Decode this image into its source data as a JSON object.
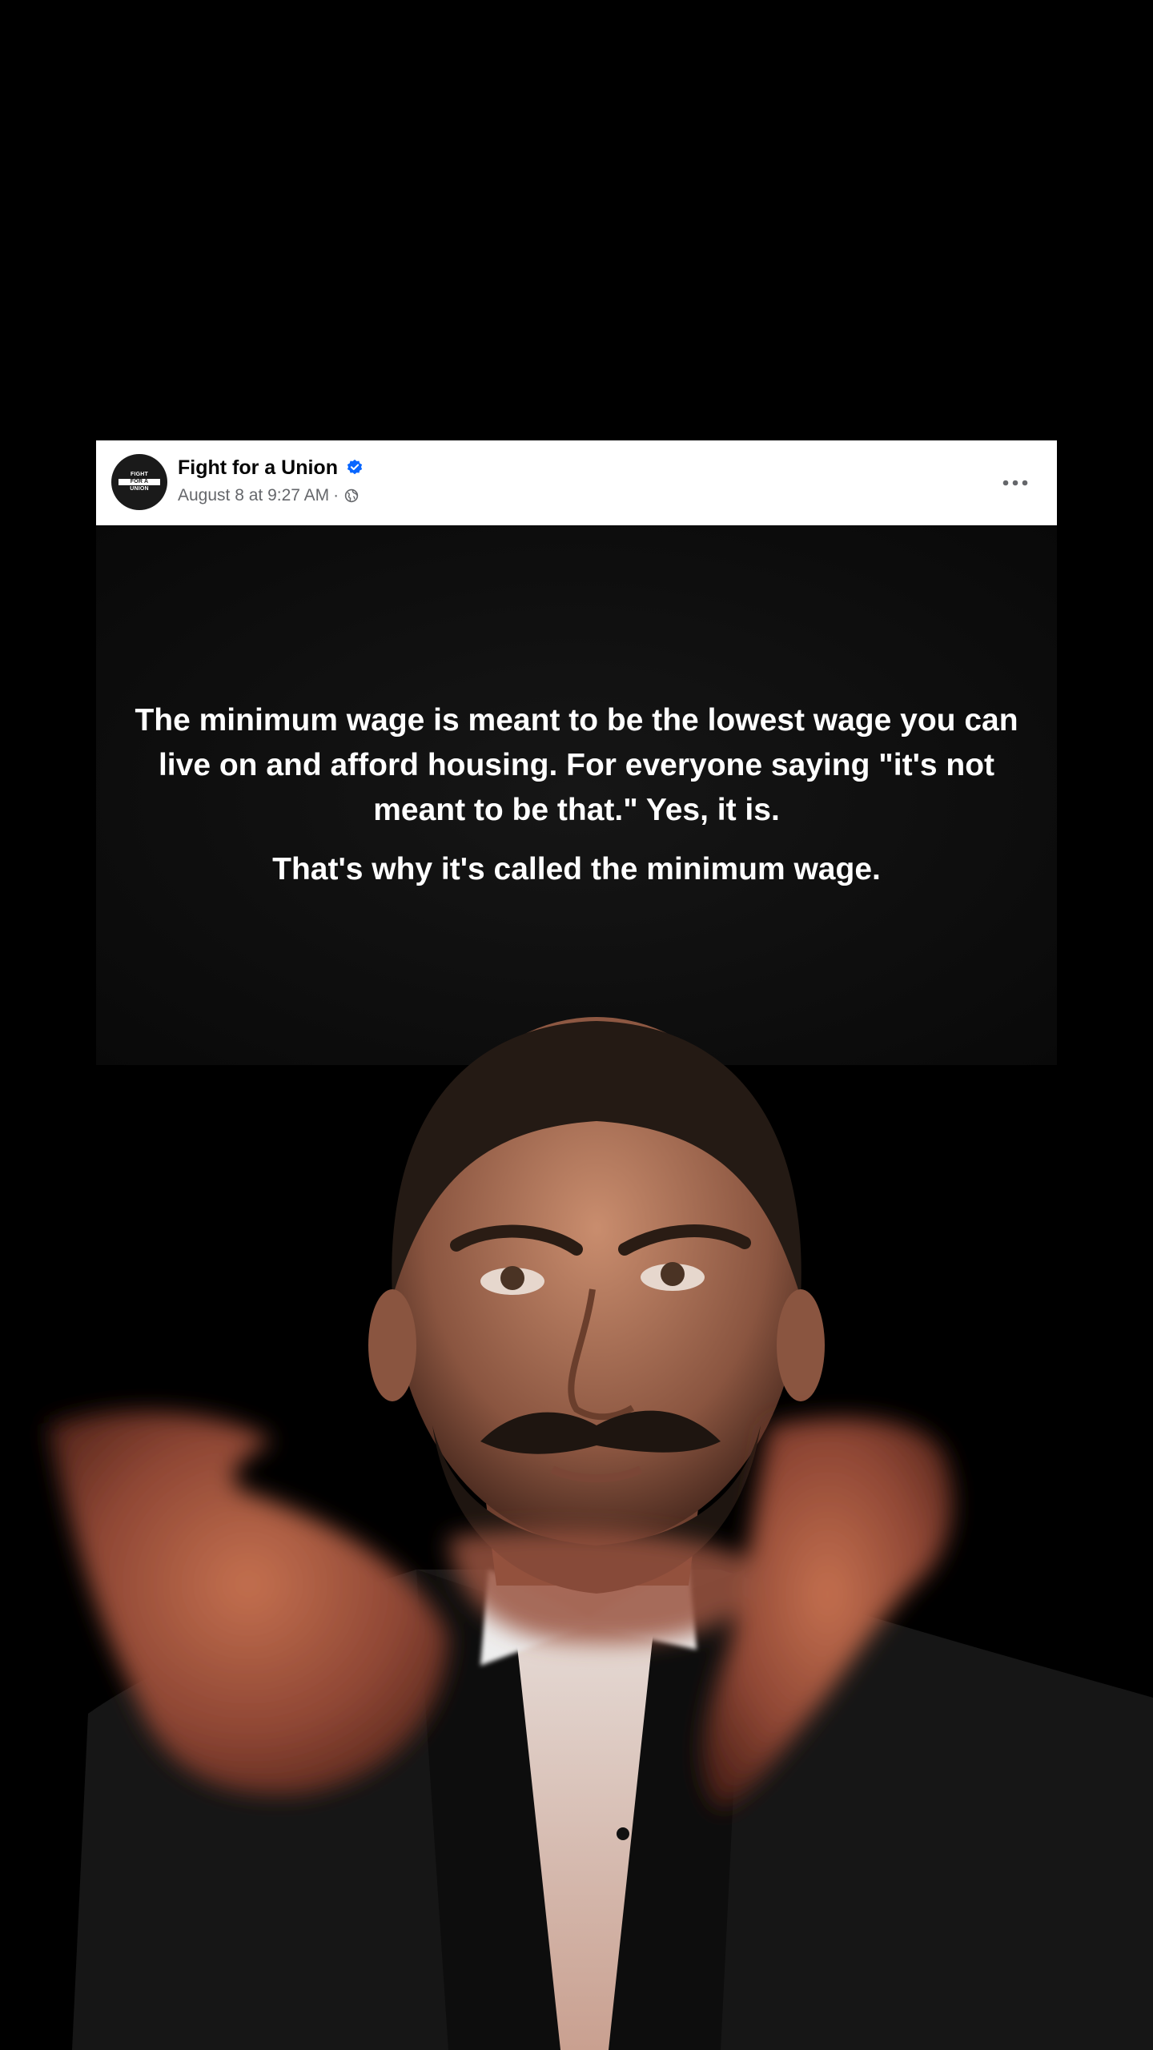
{
  "post": {
    "page_name": "Fight for a Union",
    "timestamp": "August 8 at 9:27 AM",
    "separator": "·",
    "audience_icon": "globe-icon",
    "verified_icon": "verified-badge-icon",
    "more_icon": "more-options-icon",
    "avatar_logo": [
      "FIGHT",
      "FOR A",
      "UNION"
    ],
    "quote_main": "The minimum wage is meant to be the lowest wage you can live on and afford housing. For everyone saying \"it's not meant to be that.\" Yes, it is.",
    "quote_tail": "That's why it's called the minimum wage."
  },
  "colors": {
    "background": "#000000",
    "header_background": "#ffffff",
    "name_text": "#050505",
    "meta_text": "#65676b",
    "verified_blue": "#0866ff",
    "quote_text": "#ffffff"
  }
}
